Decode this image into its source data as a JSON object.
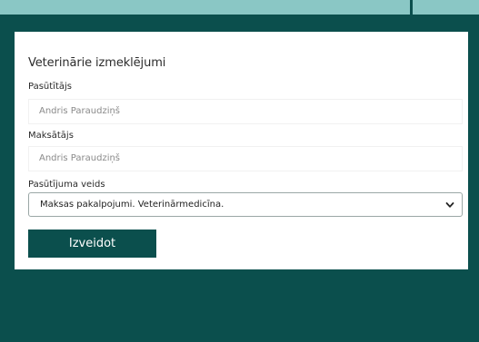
{
  "form": {
    "title": "Veterinārie izmeklējumi",
    "orderer_label": "Pasūtītājs",
    "orderer_value": "Andris Paraudziņš",
    "payer_label": "Maksātājs",
    "payer_value": "Andris Paraudziņš",
    "order_type_label": "Pasūtījuma veids",
    "order_type_selected": "Maksas pakalpojumi. Veterinārmedicīna.",
    "submit_label": "Izveidot"
  },
  "icons": {
    "select_arrow": "chevron-down-icon"
  },
  "colors": {
    "background": "#0b4f4d",
    "top_strip": "#8ac7c5",
    "button": "#0b4f4d",
    "card": "#ffffff"
  }
}
